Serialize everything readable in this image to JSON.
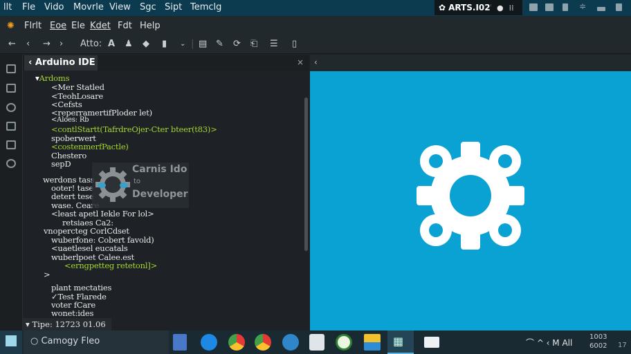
{
  "topbar": {
    "menus": [
      "llt",
      "Fle",
      "Vido",
      "Movrle",
      "View",
      "Sgc",
      "Sipt",
      "Temclg"
    ],
    "tray_label": "ARTS.I02'"
  },
  "menubar": {
    "items": [
      "Flrlt",
      "Eoe",
      "Ele",
      "Kdet",
      "Fdt",
      "Help"
    ]
  },
  "toolbar": {
    "label": "Atto:"
  },
  "sidebar": {
    "tab_title": "Arduino IDE",
    "close": "×",
    "lines": [
      "Ardoms",
      "<Mer Statled",
      "<TeohLosare",
      "<Cefsts",
      "<reperramertifPloder let)",
      "<Aloes: Rb",
      "<contlStartt(TafrdreOjer-Cter bteer(t83)>",
      "spoberwert",
      "<costenmerfPactle)",
      "Chestero",
      "sepD",
      "werdons tass",
      "ooter! tase",
      "detert tese",
      "wase. Ceare",
      "<least apetl Iekle For lol>",
      "retsiaes Ca2:",
      "vnopercteg CorlCdset",
      "wuberfone: Cobert favold)",
      "<uaetlesel eucatals",
      "wuberlpoet Calee.est",
      "<erngpetteg retetonl]>",
      ">",
      "plant mectaties",
      "Test Flarede",
      "voter fCare",
      "wonet:ides"
    ],
    "status": "Tipe: 12723 01.06"
  },
  "watermark": {
    "line1": "Carnis Ido",
    "line2": "to",
    "line3": "Developer"
  },
  "right_panel": {
    "back": "‹",
    "background": "#0aa2d3"
  },
  "taskbar": {
    "search": "Camogy Fleo",
    "clock_time": "1003",
    "clock_date": "6002",
    "tray_text": "⌒ ^ ‹ M All",
    "extra": "17"
  }
}
